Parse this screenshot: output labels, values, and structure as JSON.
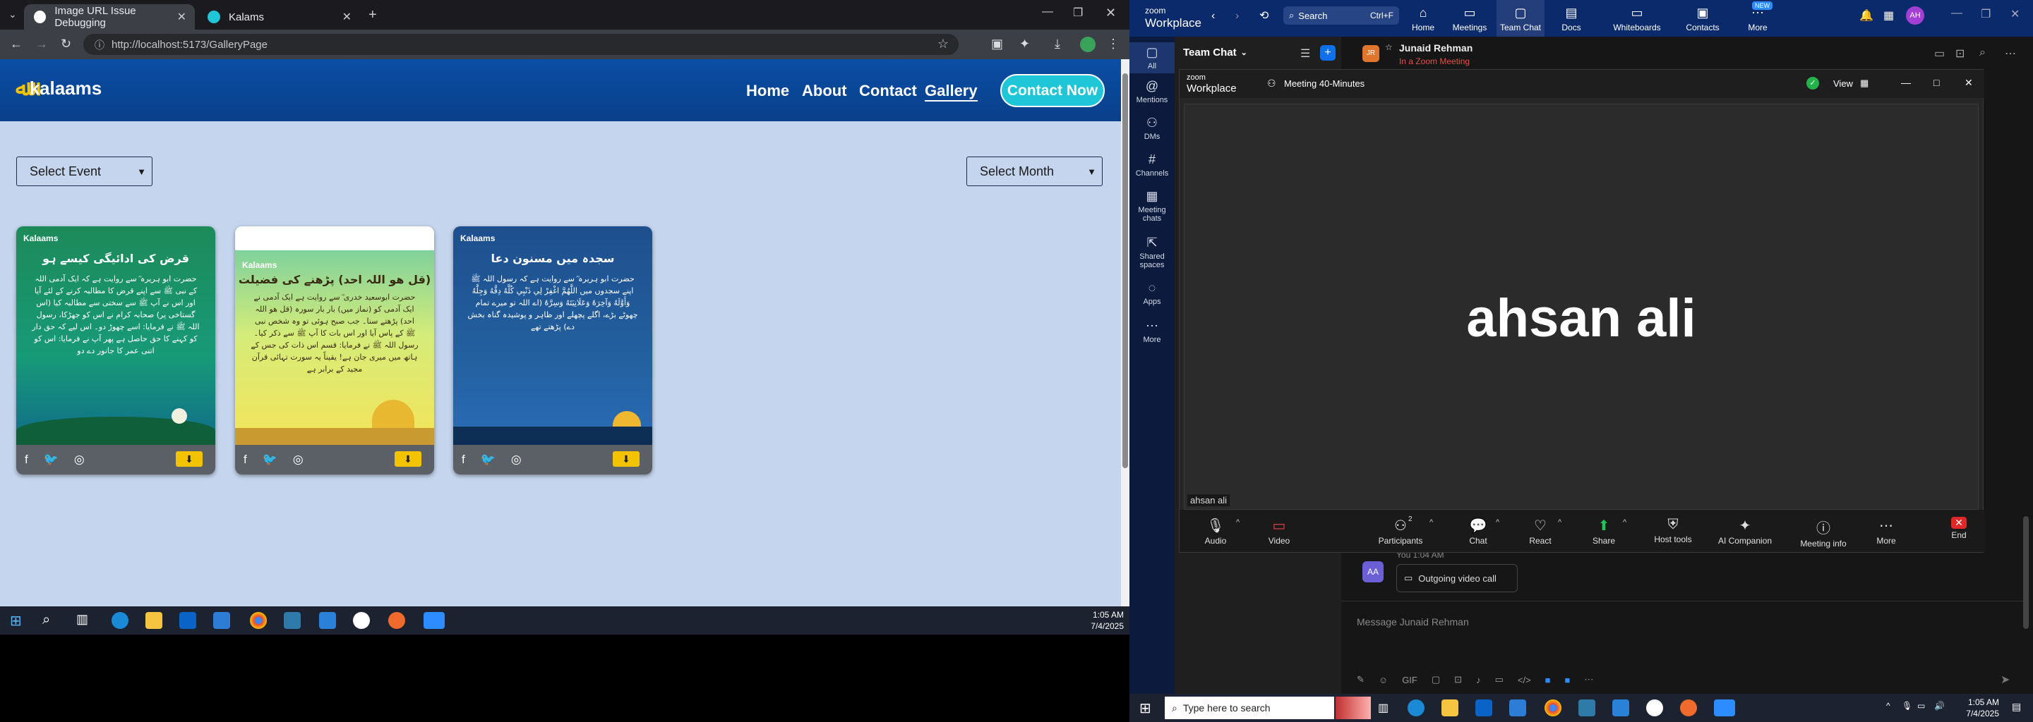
{
  "browser": {
    "tabs": [
      {
        "title": "Image URL Issue Debugging",
        "active": true
      },
      {
        "title": "Kalams",
        "active": false
      }
    ],
    "url": "http://localhost:5173/GalleryPage"
  },
  "site": {
    "logo": "kalaams",
    "nav": [
      "Home",
      "About",
      "Contact",
      "Gallery"
    ],
    "cta": "Contact Now",
    "filters": {
      "event": "Select Event",
      "month": "Select Month"
    },
    "cards": [
      {
        "brand": "Kalaams",
        "title": "قرض کی ادائیگی کیسے ہو",
        "text": "حضرت ابو ہریرہ ؓ سے روایت ہے کہ ایک آدمی اللہ کے نبی ﷺ سے اپنے قرض کا مطالبہ کرنے کے لئے آیا اور اس نے آپ ﷺ سے سختی سے مطالبہ کیا (اس گستاخی پر) صحابہ کرام نے اس کو جھڑکا، رسول اللہ ﷺ نے فرمایا: اسے چھوڑ دو۔ اس لیے کہ حق دار کو کہنے کا حق حاصل ہے پھر آپ نے فرمایا: اس کو اتنی عمر کا جانور دے دو",
        "colors": [
          "#1d8a59",
          "#0f6b8a"
        ]
      },
      {
        "brand": "Kalaams",
        "title": "(قل ھو اللہ احد) پڑھنے کی فضیلت",
        "text": "حضرت ابوسعید خدری ؓ سے روایت ہے ایک آدمی نے ایک آدمی کو (نماز میں) بار بار سورہ (قل ھو اللہ احد) پڑھتے سنا۔ جب صبح ہوئی تو وہ شخص نبی ﷺ کے پاس آیا اور اس بات کا آپ ﷺ سے ذکر کیا۔ رسول اللہ ﷺ نے فرمایا: قسم اس ذات کی جس کے ہاتھ میں میری جان ہے! یقیناً یہ سورت تہائی قرآن مجید کے برابر ہے",
        "colors": [
          "#7fcf98",
          "#f0e65a"
        ]
      },
      {
        "brand": "Kalaams",
        "title": "سجدہ میں مسنون دعا",
        "text": "حضرت ابو ہریرہ ؓ سے روایت ہے کہ رسول اللہ ﷺ اپنے سجدوں میں اللَّهُمَّ اغْفِرْ لِي ذَنْبِي كُلَّهُ دِقَّهُ وَجِلَّهُ وَأَوَّلَهُ وَآخِرَهُ وَعَلَانِيَتَهُ وَسِرَّهُ (اے اللہ تو میرے تمام چھوٹے بڑے، اگلے پچھلے اور ظاہر و پوشیدہ گناہ بخش دے) پڑھتے تھے",
        "colors": [
          "#1e4f8e",
          "#2a6cb8"
        ]
      }
    ]
  },
  "taskbar_left": {
    "time": "1:05 AM",
    "date": "7/4/2025"
  },
  "zoom": {
    "brand_line1": "zoom",
    "brand_line2": "Workplace",
    "search_label": "Search",
    "search_shortcut": "Ctrl+F",
    "top_nav": [
      "Home",
      "Meetings",
      "Team Chat",
      "Docs",
      "Whiteboards",
      "Contacts",
      "More"
    ],
    "new_badge": "NEW",
    "avatar": "AH",
    "sidebar": [
      "All",
      "Mentions",
      "DMs",
      "Channels",
      "Meeting chats",
      "Shared spaces",
      "Apps",
      "More"
    ],
    "panel_title": "Team Chat",
    "contact_name": "Junaid Rehman",
    "contact_initials": "JR",
    "contact_status": "In a Zoom Meeting",
    "meeting": {
      "title": "Meeting 40-Minutes",
      "view_label": "View",
      "participant": "ahsan ali",
      "name_tag": "ahsan ali",
      "participants_count": "2",
      "controls": [
        "Audio",
        "Video",
        "Participants",
        "Chat",
        "React",
        "Share",
        "Host tools",
        "AI Companion",
        "Meeting info",
        "More",
        "End"
      ]
    },
    "call_time": "You 1:04 AM",
    "call_initials": "AA",
    "call_label": "Outgoing video call",
    "message_placeholder": "Message Junaid Rehman"
  },
  "taskbar_right": {
    "search_placeholder": "Type here to search",
    "time": "1:05 AM",
    "date": "7/4/2025"
  }
}
